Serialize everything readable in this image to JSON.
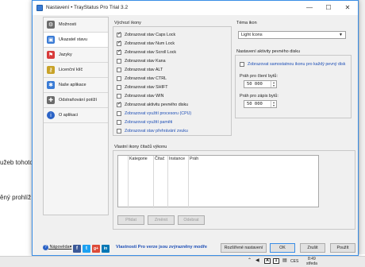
{
  "background": {
    "text_line_1": "užeb tohoto",
    "text_line_2": "ěný prohlíž"
  },
  "window": {
    "title": "Nastavení • TrayStatus Pro Trial 3.2",
    "minimize": "—",
    "maximize": "☐",
    "close": "✕"
  },
  "sidebar": {
    "items": [
      {
        "label": "Možnosti",
        "icon": "gear-icon",
        "color": "#6b6b6b"
      },
      {
        "label": "Ukazatel stavu",
        "icon": "status-icon",
        "color": "#3a7bd5"
      },
      {
        "label": "Jazyky",
        "icon": "flag-icon",
        "color": "#d83b3b"
      },
      {
        "label": "Licenční klíč",
        "icon": "key-icon",
        "color": "#c8a228"
      },
      {
        "label": "Naše aplikace",
        "icon": "apps-icon",
        "color": "#3a7bd5"
      },
      {
        "label": "Odstraňování potíží",
        "icon": "tools-icon",
        "color": "#6b6b6b"
      },
      {
        "label": "O aplikaci",
        "icon": "info-icon",
        "color": "#2b63c6"
      }
    ]
  },
  "default_icons": {
    "title": "Výchozí ikony",
    "options": [
      {
        "label": "Zobrazovat stav Caps Lock",
        "checked": true,
        "blue": false
      },
      {
        "label": "Zobrazovat stav Num Lock",
        "checked": true,
        "blue": false
      },
      {
        "label": "Zobrazovat stav Scroll Lock",
        "checked": true,
        "blue": false
      },
      {
        "label": "Zobrazovat stav Kana",
        "checked": false,
        "blue": false
      },
      {
        "label": "Zobrazovat stav ALT",
        "checked": false,
        "blue": false
      },
      {
        "label": "Zobrazovat stav CTRL",
        "checked": false,
        "blue": false
      },
      {
        "label": "Zobrazovat stav SHIFT",
        "checked": false,
        "blue": false
      },
      {
        "label": "Zobrazovat stav WIN",
        "checked": false,
        "blue": false
      },
      {
        "label": "Zobrazovat aktivitu pevného disku",
        "checked": true,
        "blue": false
      },
      {
        "label": "Zobrazovat využití procesoru (CPU)",
        "checked": false,
        "blue": true
      },
      {
        "label": "Zobrazovat využití paměti",
        "checked": false,
        "blue": true
      },
      {
        "label": "Zobrazovat stav přehrávání zvuku",
        "checked": false,
        "blue": true
      }
    ]
  },
  "theme": {
    "title": "Téma ikon",
    "selected": "Light Icons",
    "arrow": "▼"
  },
  "disk": {
    "title": "Nastavení aktivity pevného disku",
    "separate_icon_label": "Zobrazovat samostatnou ikonu pro každý pevný disk",
    "separate_icon_checked": false,
    "read_label": "Práh pro čtení bytů:",
    "read_value": "50 000",
    "write_label": "Práh pro zápis bytů:",
    "write_value": "50 000",
    "spin_up": "▲",
    "spin_down": "▼"
  },
  "counters": {
    "title": "Vlastní ikony čítačů výkonu",
    "columns": [
      "Kategorie",
      "Čítač",
      "Instance",
      "Práh"
    ],
    "add": "Přidat",
    "edit": "Změnit",
    "remove": "Odebrat"
  },
  "footer": {
    "help": "Nápověda",
    "help_arrow": "▾",
    "social": [
      {
        "name": "facebook-icon",
        "glyph": "f",
        "color": "#3b5998"
      },
      {
        "name": "twitter-icon",
        "glyph": "t",
        "color": "#1da1f2"
      },
      {
        "name": "google-plus-icon",
        "glyph": "g+",
        "color": "#dd4b39"
      },
      {
        "name": "linkedin-icon",
        "glyph": "in",
        "color": "#0077b5"
      }
    ],
    "promo": "Vlastnosti Pro verze jsou zvýrazněny modře",
    "advanced": "Rozšířené nastavení",
    "ok": "OK",
    "cancel": "Zrušit",
    "apply": "Použít"
  },
  "taskbar": {
    "time": "8:49",
    "day": "středa",
    "lang": "CES",
    "tray_a": "A",
    "tray_1": "1"
  }
}
